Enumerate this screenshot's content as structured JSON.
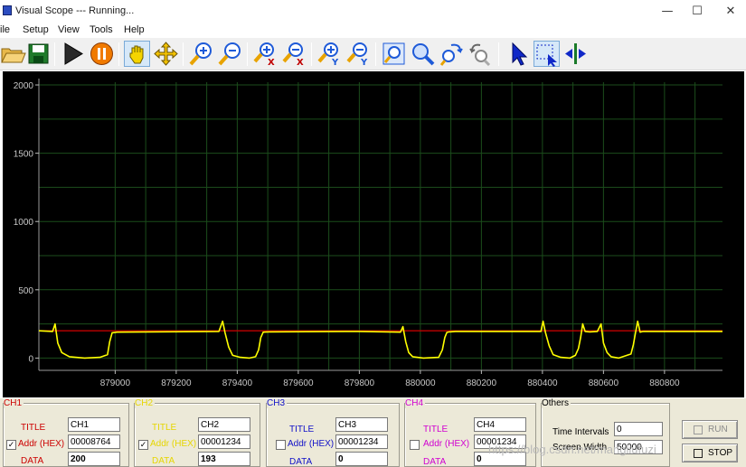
{
  "window": {
    "title": "Visual Scope  ---  Running...",
    "controls": [
      "—",
      "☐",
      "✕"
    ]
  },
  "menu": [
    "ile",
    "Setup",
    "View",
    "Tools",
    "Help"
  ],
  "toolbar": [
    {
      "name": "open-icon",
      "color": "#e8b84a"
    },
    {
      "name": "save-icon",
      "color": "#1f7a2a"
    },
    {
      "name": "run-icon",
      "color": "#2a2a2a"
    },
    {
      "name": "pause-icon",
      "color": "#f07a00"
    },
    {
      "name": "hand-icon",
      "color": "#f5d400"
    },
    {
      "name": "move-icon",
      "color": "#f5c400"
    },
    {
      "name": "zoom-in-icon",
      "color": "#1e5ad8"
    },
    {
      "name": "zoom-out-icon",
      "color": "#1e5ad8"
    },
    {
      "name": "zoom-in-x-icon",
      "color": "#1e5ad8"
    },
    {
      "name": "zoom-out-x-icon",
      "color": "#1e5ad8"
    },
    {
      "name": "zoom-in-y-icon",
      "color": "#1e5ad8"
    },
    {
      "name": "zoom-out-y-icon",
      "color": "#1e5ad8"
    },
    {
      "name": "zoom-fit-icon",
      "color": "#1e5ad8"
    },
    {
      "name": "zoom-icon",
      "color": "#1e5ad8"
    },
    {
      "name": "undo-zoom-icon",
      "color": "#1e5ad8"
    },
    {
      "name": "redo-zoom-icon",
      "color": "#888888"
    },
    {
      "name": "pointer-icon",
      "color": "#1028c8"
    },
    {
      "name": "select-region-icon",
      "color": "#1028c8"
    },
    {
      "name": "cursor-split-icon",
      "color": "#1a7a2a"
    }
  ],
  "chart_data": {
    "type": "line",
    "xlabel": "",
    "ylabel": "",
    "xlim": [
      878750,
      880990
    ],
    "ylim": [
      -90,
      2020
    ],
    "yticks": [
      0,
      500,
      1000,
      1500,
      2000
    ],
    "xticks": [
      879000,
      879200,
      879400,
      879600,
      879800,
      880000,
      880200,
      880400,
      880600,
      880800
    ],
    "ytick_labels": [
      "0",
      "500",
      "1000",
      "1500",
      "2000"
    ],
    "xtick_labels": [
      "879000",
      "879200",
      "879400",
      "879600",
      "879800",
      "880000",
      "880200",
      "880400",
      "880600",
      "880800"
    ],
    "grid": true,
    "background": "#000000",
    "grid_color": "#1b4d1b",
    "series": [
      {
        "color": "#ffff00",
        "x": [
          878750,
          878795,
          878803,
          878812,
          878825,
          878850,
          878900,
          878950,
          878975,
          878982,
          878990,
          879007,
          879340,
          879352,
          879360,
          879372,
          879385,
          879410,
          879440,
          879460,
          879470,
          879477,
          879485,
          879502,
          879800,
          879935,
          879943,
          879952,
          879962,
          879975,
          880010,
          880060,
          880072,
          880080,
          880087,
          880095,
          880115,
          880395,
          880402,
          880410,
          880422,
          880435,
          880460,
          880490,
          880508,
          880518,
          880525,
          880532,
          880540,
          880555,
          880580,
          880592,
          880600,
          880612,
          880625,
          880650,
          880690,
          880698,
          880705,
          880712,
          880720,
          880730,
          880990
        ],
        "y": [
          200,
          195,
          250,
          110,
          40,
          10,
          0,
          5,
          25,
          120,
          185,
          190,
          195,
          270,
          185,
          80,
          20,
          5,
          0,
          10,
          60,
          150,
          190,
          192,
          195,
          190,
          230,
          120,
          40,
          10,
          0,
          5,
          60,
          150,
          188,
          192,
          195,
          195,
          270,
          185,
          90,
          25,
          5,
          0,
          20,
          70,
          150,
          250,
          195,
          192,
          195,
          250,
          110,
          40,
          10,
          0,
          30,
          100,
          185,
          270,
          190,
          195,
          195
        ]
      },
      {
        "color": "#c00000",
        "x": [
          878750,
          880990
        ],
        "y": [
          200,
          200
        ]
      }
    ]
  },
  "channels": [
    {
      "label": "CH1",
      "color": "#cc0000",
      "title_label": "TITLE",
      "addr_label": "Addr (HEX)",
      "data_label": "DATA",
      "title": "CH1",
      "addr": "00008764",
      "data": "200",
      "checked": true,
      "check_mark": "✓"
    },
    {
      "label": "CH2",
      "color": "#e6d600",
      "title_label": "TITLE",
      "addr_label": "Addr (HEX)",
      "data_label": "DATA",
      "title": "CH2",
      "addr": "00001234",
      "data": "193",
      "checked": true,
      "check_mark": "✓"
    },
    {
      "label": "CH3",
      "color": "#1010c8",
      "title_label": "TITLE",
      "addr_label": "Addr (HEX)",
      "data_label": "DATA",
      "title": "CH3",
      "addr": "00001234",
      "data": "0",
      "checked": false,
      "check_mark": ""
    },
    {
      "label": "CH4",
      "color": "#d000d0",
      "title_label": "TITLE",
      "addr_label": "Addr (HEX)",
      "data_label": "DATA",
      "title": "CH4",
      "addr": "00001234",
      "data": "0",
      "checked": false,
      "check_mark": ""
    }
  ],
  "others": {
    "label": "Others",
    "time_intervals_label": "Time Intervals",
    "time_intervals": "0",
    "screen_width_label": "Screen Width",
    "screen_width": "50000"
  },
  "buttons": {
    "run": "RUN",
    "stop": "STOP"
  },
  "watermark": "https://blog.csdn.net/mangliufuzi"
}
